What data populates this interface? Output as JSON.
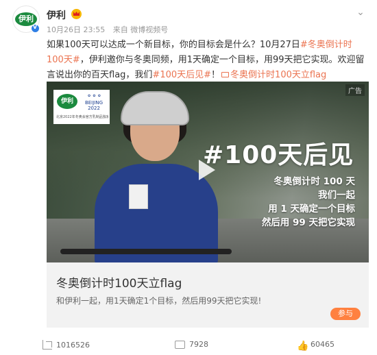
{
  "header": {
    "user_name": "伊利",
    "avatar_text": "伊利",
    "date": "10月26日 23:55",
    "source": "来自 微博视频号",
    "more_glyph": "⌄"
  },
  "post": {
    "text_a": "如果100天可以达成一个新目标，你的目标会是什么？10月27日",
    "tag_1": "#冬奥倒计时100天#",
    "text_b": "，伊利邀你与冬奥同频，用1天确定一个目标，用99天把它实现。欢迎留言说出你的百天flag，我们",
    "tag_2": "#100天后见#",
    "text_c": "！",
    "link_text": "冬奥倒计时100天立flag"
  },
  "video": {
    "ad_label": "广告",
    "logo_text": "伊利",
    "logo_event": "BEIJING 2022",
    "logo_caption": "北京2022年冬奥会官方乳制品独家供应商",
    "hashtag": "#100天后见",
    "line_1": "冬奥倒计时 100 天",
    "line_2": "我们一起",
    "line_3": "用 1 天确定一个目标",
    "line_4": "然后用 99 天把它实现"
  },
  "card": {
    "title": "冬奥倒计时100天立flag",
    "description": "和伊利一起，用1天确定1个目标，然后用99天把它实现!",
    "button_label": "参与"
  },
  "actions": {
    "share_count": "1016526",
    "comment_count": "7928",
    "like_count": "60465"
  },
  "colors": {
    "link": "#eb7350",
    "button": "#ff8140",
    "brand_green": "#1b8a3e"
  }
}
